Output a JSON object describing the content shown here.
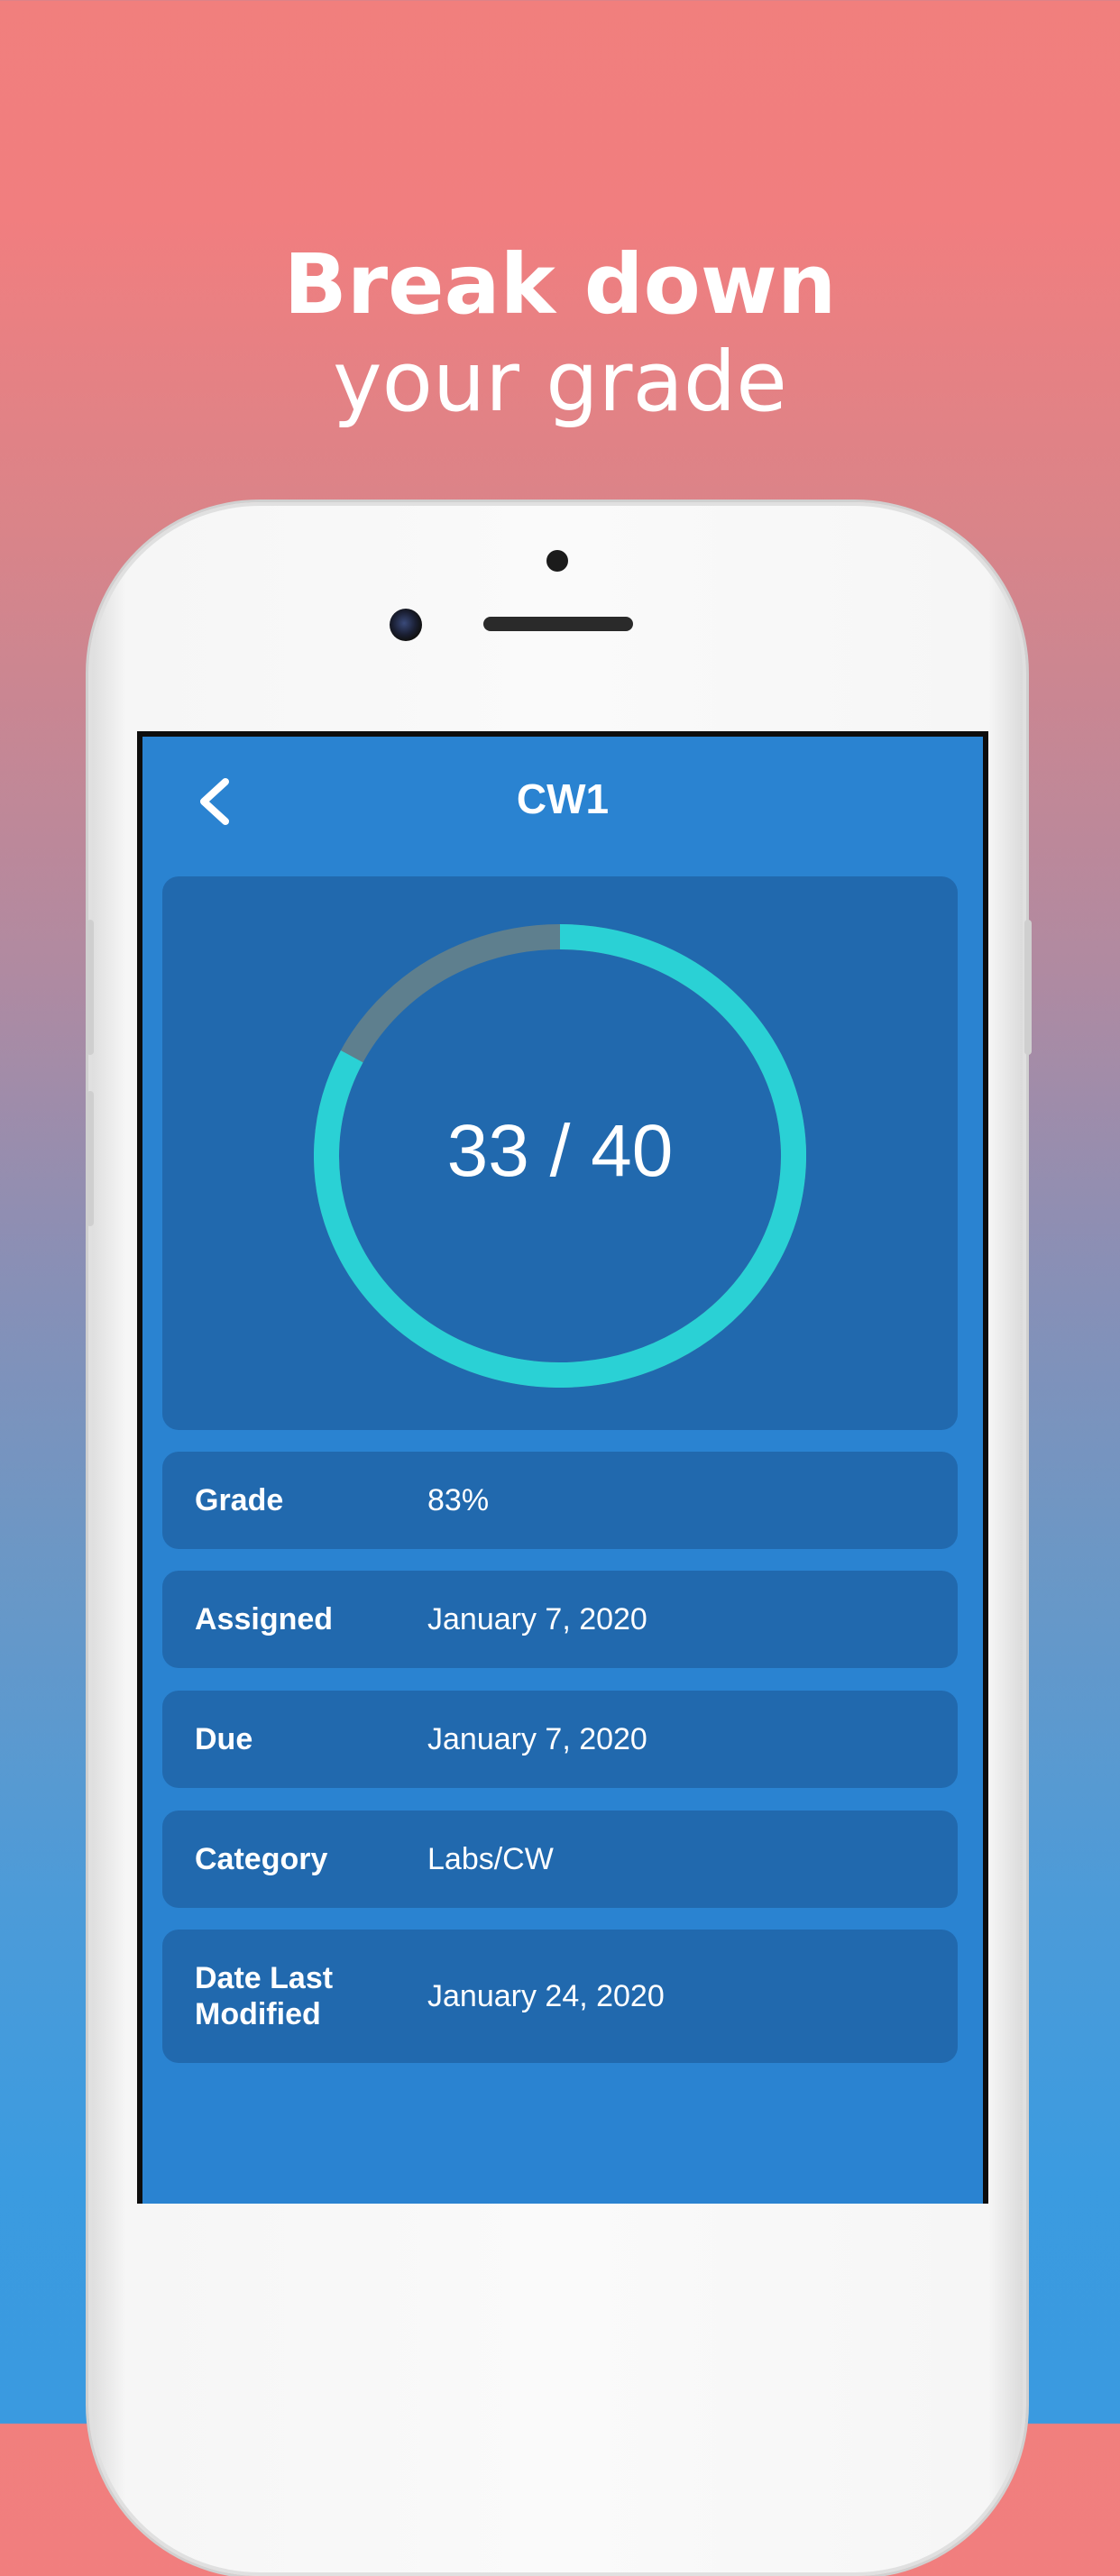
{
  "headline": {
    "line1": "Break down",
    "line2": "your grade"
  },
  "nav": {
    "title": "CW1",
    "back_icon": "chevron-left-icon"
  },
  "score": {
    "earned": 33,
    "total": 40,
    "text": "33 / 40",
    "progress_fraction": 0.825,
    "colors": {
      "progress": "#2ad1d5",
      "remainder": "#5e7f8e"
    }
  },
  "details": [
    {
      "label": "Grade",
      "value": "83%"
    },
    {
      "label": "Assigned",
      "value": "January 7, 2020"
    },
    {
      "label": "Due",
      "value": "January 7, 2020"
    },
    {
      "label": "Category",
      "value": "Labs/CW"
    },
    {
      "label": "Date Last Modified",
      "value": "January 24, 2020"
    }
  ],
  "colors": {
    "screen_bg": "#2a83d1",
    "card_bg": "#2169ae",
    "gradient_top": "#f17f7d",
    "gradient_bottom": "#3a9ae0"
  }
}
